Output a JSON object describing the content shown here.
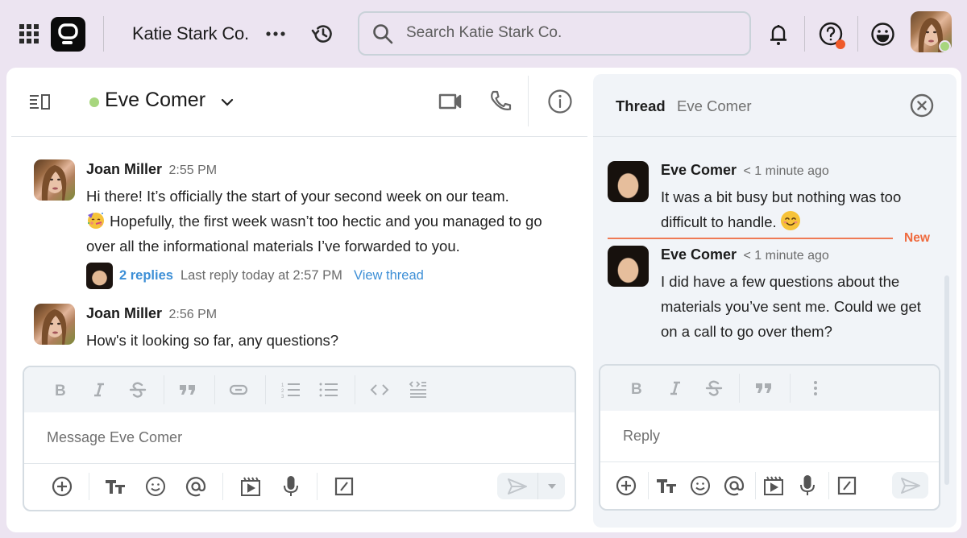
{
  "topbar": {
    "workspace_name": "Katie Stark Co.",
    "search": {
      "placeholder": "Search Katie Stark Co.",
      "value": ""
    },
    "icons": [
      "apps-grid-icon",
      "app-logo",
      "more-icon",
      "history-icon",
      "search-icon",
      "bell-icon",
      "help-icon",
      "emoji-status-icon",
      "user-avatar"
    ],
    "help_badge_color": "#ef5a2a",
    "user_status_color": "#a7d67e"
  },
  "chat": {
    "conversation_name": "Eve Comer",
    "presence_color": "#a7d67e",
    "messages": [
      {
        "author": "Joan Miller",
        "time": "2:55 PM",
        "text_line1": "Hi there! It’s officially the start of your second week on our team.",
        "text_line2": " Hopefully, the first week wasn’t too hectic and you managed to go over all the informational materials I’ve forwarded to you.",
        "emoji": "partying-face",
        "thread": {
          "replies": "2 replies",
          "last_reply": "Last reply today at 2:57 PM",
          "view_thread": "View thread"
        }
      },
      {
        "author": "Joan Miller",
        "time": "2:56 PM",
        "text": "How's it looking so far, any questions?"
      }
    ],
    "composer": {
      "placeholder": "Message Eve Comer",
      "value": "",
      "format_tools": [
        "bold",
        "italic",
        "strikethrough",
        "quote",
        "link",
        "numbered-list",
        "bulleted-list",
        "code",
        "code-block"
      ],
      "actions": [
        "add",
        "text-format",
        "emoji",
        "mention",
        "video-clip",
        "voice",
        "slash-command",
        "send",
        "send-options"
      ]
    }
  },
  "thread": {
    "title": "Thread",
    "subtitle": "Eve Comer",
    "new_label": "New",
    "new_color": "#ef6a3e",
    "messages": [
      {
        "author": "Eve Comer",
        "time": "< 1 minute ago",
        "text": "It was a bit busy but nothing was too difficult to handle.",
        "emoji": "smiling-face"
      },
      {
        "author": "Eve Comer",
        "time": "< 1 minute ago",
        "text": "I did have a few questions about the materials you’ve sent me. Could we get on a call to go over them?"
      }
    ],
    "composer": {
      "placeholder": "Reply",
      "value": "",
      "format_tools": [
        "bold",
        "italic",
        "strikethrough",
        "quote",
        "more"
      ],
      "actions": [
        "add",
        "text-format",
        "emoji",
        "mention",
        "video-clip",
        "voice",
        "slash-command",
        "send"
      ]
    }
  },
  "colors": {
    "background": "#ece4f1",
    "link": "#3d8fd6",
    "panel": "#ffffff",
    "thread_panel": "#f1f4f8"
  }
}
